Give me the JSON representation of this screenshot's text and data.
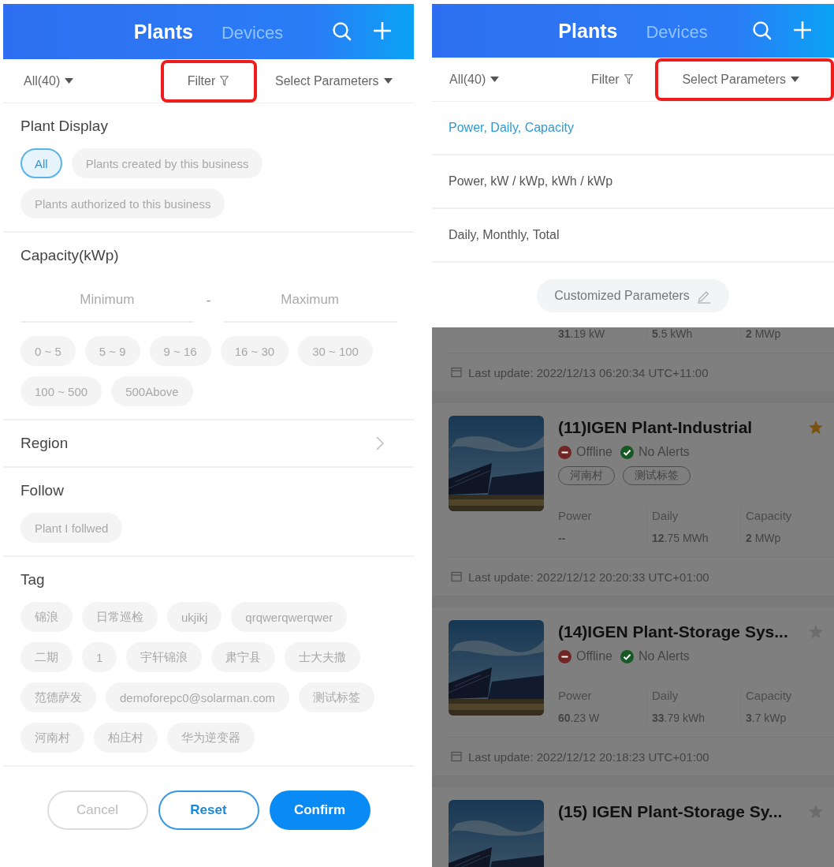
{
  "left_screen": {
    "header": {
      "tabs": [
        {
          "label": "Plants",
          "selected": true
        },
        {
          "label": "Devices",
          "selected": false
        }
      ]
    },
    "toolbar": [
      {
        "label": "All(40)",
        "kind": "dropdown",
        "highlighted": false
      },
      {
        "label": "Filter",
        "kind": "filter",
        "highlighted": true
      },
      {
        "label": "Select Parameters",
        "kind": "dropdown",
        "highlighted": false
      }
    ],
    "plant_display": {
      "title": "Plant Display",
      "chips": [
        {
          "label": "All",
          "selected": true
        },
        {
          "label": "Plants created by this business",
          "selected": false
        },
        {
          "label": "Plants authorized to this business",
          "selected": false
        }
      ]
    },
    "capacity": {
      "title": "Capacity(kWp)",
      "minimum": {
        "placeholder": "Minimum"
      },
      "separator": "-",
      "maximum": {
        "placeholder": "Maximum"
      },
      "chips": [
        {
          "label": "0 ~ 5",
          "selected": false
        },
        {
          "label": "5 ~ 9",
          "selected": false
        },
        {
          "label": "9 ~ 16",
          "selected": false
        },
        {
          "label": "16 ~ 30",
          "selected": false
        },
        {
          "label": "30 ~ 100",
          "selected": false
        },
        {
          "label": "100 ~ 500",
          "selected": false
        },
        {
          "label": "500Above",
          "selected": false
        }
      ]
    },
    "region": {
      "title": "Region"
    },
    "follow": {
      "title": "Follow",
      "chips": [
        {
          "label": "Plant I follwed",
          "selected": false
        }
      ]
    },
    "tag": {
      "title": "Tag",
      "chips": [
        {
          "label": "锦浪",
          "selected": false
        },
        {
          "label": "日常巡检",
          "selected": false
        },
        {
          "label": "ukjikj",
          "selected": false
        },
        {
          "label": "qrqwerqwerqwer",
          "selected": false
        },
        {
          "label": "二期",
          "selected": false
        },
        {
          "label": "1",
          "selected": false
        },
        {
          "label": "宇轩锦浪",
          "selected": false
        },
        {
          "label": "肃宁县",
          "selected": false
        },
        {
          "label": "士大夫撒",
          "selected": false
        },
        {
          "label": "范德萨发",
          "selected": false
        },
        {
          "label": "demoforepc0@solarman.com",
          "selected": false
        },
        {
          "label": "测试标签",
          "selected": false
        },
        {
          "label": "河南村",
          "selected": false
        },
        {
          "label": "柏庄村",
          "selected": false
        },
        {
          "label": "华为逆变器",
          "selected": false
        }
      ]
    },
    "buttons": [
      {
        "label": "Cancel",
        "kind": "cancel"
      },
      {
        "label": "Reset",
        "kind": "reset"
      },
      {
        "label": "Confirm",
        "kind": "confirm"
      }
    ]
  },
  "right_screen": {
    "header": {
      "tabs": [
        {
          "label": "Plants",
          "selected": true
        },
        {
          "label": "Devices",
          "selected": false
        }
      ]
    },
    "toolbar": [
      {
        "label": "All(40)",
        "kind": "dropdown",
        "highlighted": false
      },
      {
        "label": "Filter",
        "kind": "filter",
        "highlighted": false
      },
      {
        "label": "Select Parameters",
        "kind": "dropdown",
        "highlighted": true
      }
    ],
    "parameter_options": [
      {
        "label": "Power, Daily, Capacity",
        "selected": true
      },
      {
        "label": "Power, kW / kWp, kWh / kWp",
        "selected": false
      },
      {
        "label": "Daily, Monthly, Total",
        "selected": false
      }
    ],
    "customize_button": {
      "label": "Customized Parameters"
    },
    "plants": [
      {
        "kind": "partial",
        "stats": [
          {
            "value": "**31**.19 kW"
          },
          {
            "value": "**5**.5 kWh"
          },
          {
            "value": "**2** MWp"
          }
        ],
        "last_update": "Last update: 2022/12/13 06:20:34 UTC+11:00"
      },
      {
        "kind": "full",
        "image": {
          "kind": "picture"
        },
        "title": "(11)IGEN Plant-Industrial",
        "starred": true,
        "statuses": [
          {
            "label": "Offline",
            "kind": "offline",
            "color": "#712626"
          },
          {
            "label": "No Alerts",
            "kind": "ok",
            "color": "#165925"
          }
        ],
        "tags": [
          "河南村",
          "测试标签"
        ],
        "stats": [
          {
            "label": "Power",
            "value": "**--**"
          },
          {
            "label": "Daily",
            "value": "**12**.75 MWh"
          },
          {
            "label": "Capacity",
            "value": "**2** MWp"
          }
        ],
        "last_update": "Last update: 2022/12/12 20:20:33 UTC+01:00"
      },
      {
        "kind": "full",
        "image": {
          "kind": "picture"
        },
        "title": "(14)IGEN Plant-Storage Sys...",
        "starred": false,
        "statuses": [
          {
            "label": "Offline",
            "kind": "offline",
            "color": "#712626"
          },
          {
            "label": "No Alerts",
            "kind": "ok",
            "color": "#165925"
          }
        ],
        "stats": [
          {
            "label": "Power",
            "value": "**60**.23 W"
          },
          {
            "label": "Daily",
            "value": "**33**.79 kWh"
          },
          {
            "label": "Capacity",
            "value": "**3**.7 kWp"
          }
        ],
        "last_update": "Last update: 2022/12/12 20:18:23 UTC+01:00"
      },
      {
        "kind": "cut",
        "image": {
          "kind": "picture"
        },
        "title": "(15) IGEN Plant-Storage Sy...",
        "starred": false
      }
    ]
  }
}
